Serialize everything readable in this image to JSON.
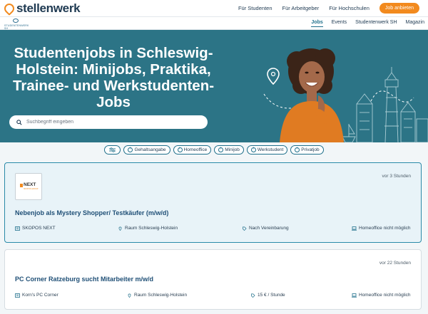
{
  "brand": {
    "name": "stellenwerk",
    "sub_logo": "STUDENTENWERK SH",
    "accent": "#f28a1e",
    "teal": "#2c7486"
  },
  "topnav": {
    "items": [
      "Für Studenten",
      "Für Arbeitgeber",
      "Für Hochschulen"
    ],
    "cta": "Job anbieten"
  },
  "subnav": {
    "items": [
      "Jobs",
      "Events",
      "Studentenwerk SH",
      "Magazin"
    ],
    "active": "Jobs"
  },
  "hero": {
    "title": "Studentenjobs in Schleswig-Holstein: Minijobs, Praktika, Trainee- und Werkstudenten-Jobs",
    "search_placeholder": "Suchbegriff eingeben"
  },
  "filters": [
    "Gehaltsangabe",
    "Homeoffice",
    "Minijob",
    "Werkstudent",
    "Privatjob"
  ],
  "jobs": [
    {
      "time": "vor 3 Stunden",
      "title": "Nebenjob als Mystery Shopper/ Testkäufer (m/w/d)",
      "company": "SKOPOS NEXT",
      "logo_text": "NEXT",
      "logo_sub": "SKOPOS GROUP",
      "location": "Raum Schleswig-Holstein",
      "pay": "Nach Vereinbarung",
      "homeoffice": "Homeoffice nicht möglich"
    },
    {
      "time": "vor 22 Stunden",
      "title": "PC Corner Ratzeburg sucht Mitarbeiter m/w/d",
      "company": "Korn's PC Corner",
      "location": "Raum Schleswig-Holstein",
      "pay": "15 € / Stunde",
      "homeoffice": "Homeoffice nicht möglich"
    }
  ]
}
